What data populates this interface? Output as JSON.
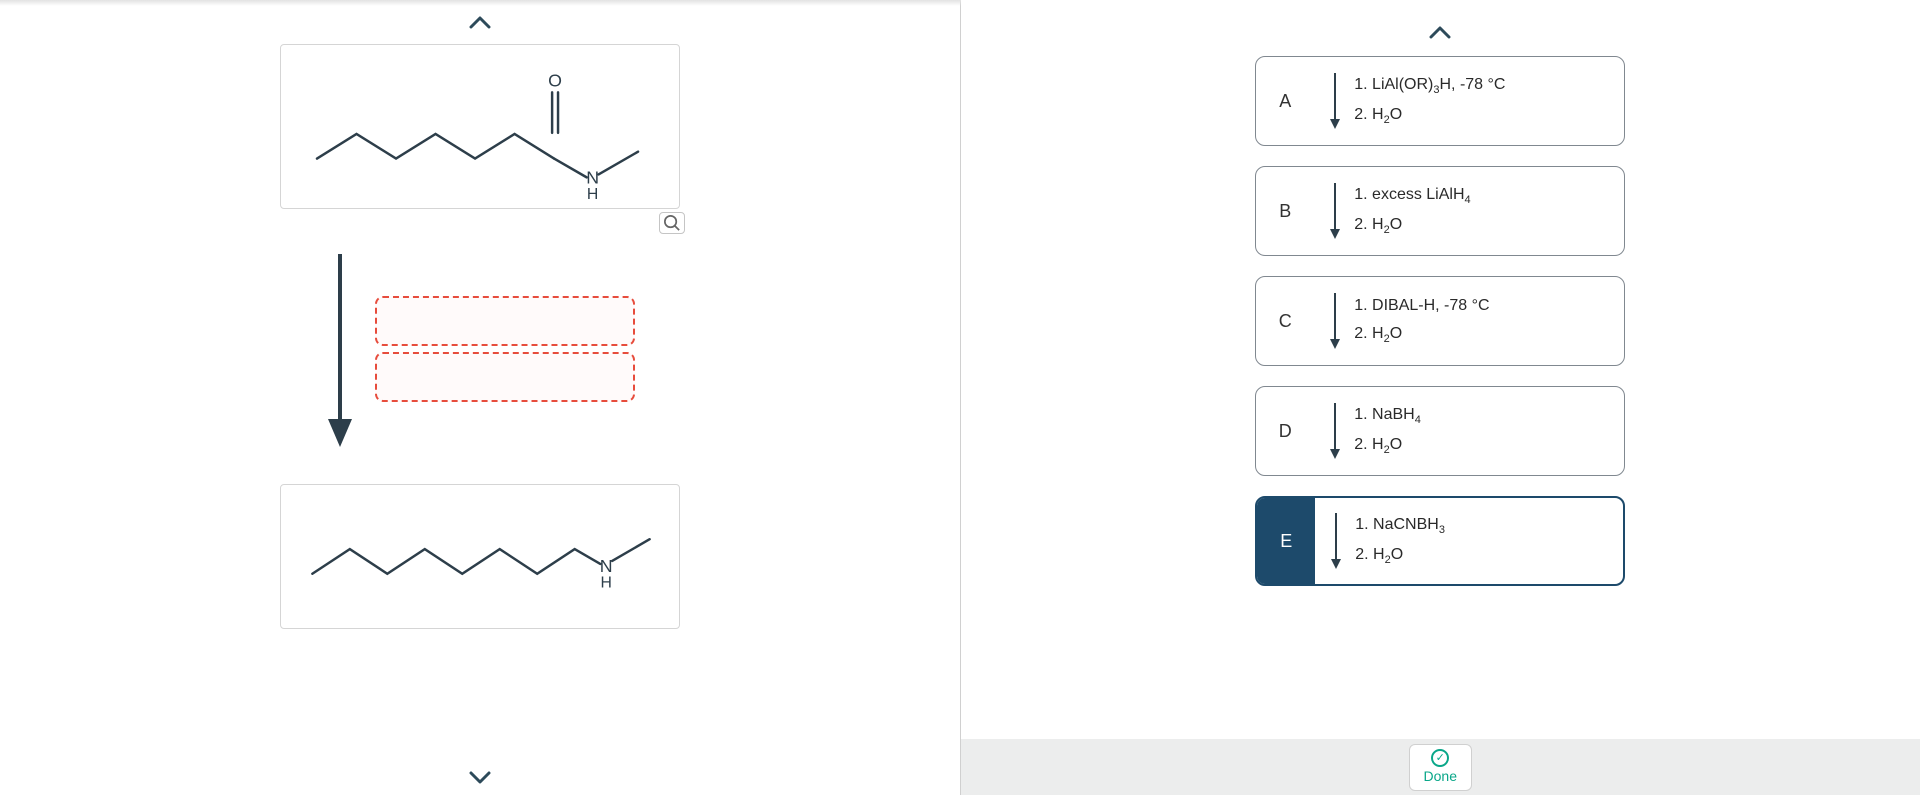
{
  "left": {
    "startLabels": {
      "O": "O",
      "N": "N",
      "H": "H"
    },
    "productLabels": {
      "N": "N",
      "H": "H"
    }
  },
  "options": [
    {
      "letter": "A",
      "line1": "1. LiAl(OR)₃H, -78 °C",
      "line2": "2. H₂O",
      "selected": false
    },
    {
      "letter": "B",
      "line1": "1. excess LiAlH₄",
      "line2": "2. H₂O",
      "selected": false
    },
    {
      "letter": "C",
      "line1": "1. DIBAL-H, -78 °C",
      "line2": "2. H₂O",
      "selected": false
    },
    {
      "letter": "D",
      "line1": "1. NaBH₄",
      "line2": "2. H₂O",
      "selected": false
    },
    {
      "letter": "E",
      "line1": "1. NaCNBH₃",
      "line2": "2. H₂O",
      "selected": true
    }
  ],
  "doneLabel": "Done"
}
